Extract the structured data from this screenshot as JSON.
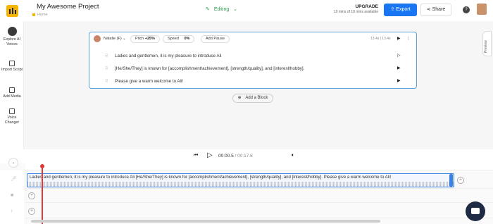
{
  "header": {
    "project_title": "My Awesome Project",
    "breadcrumb": "Home",
    "mode_label": "Editing",
    "upgrade_title": "UPGRADE",
    "upgrade_subtitle": "10 mins of 10 mins available",
    "export_label": "Export",
    "share_label": "Share",
    "help_icon": "?"
  },
  "sidebar": {
    "items": [
      {
        "label": "Explore AI Voices",
        "icon": "avatar-icon"
      },
      {
        "label": "Import Script",
        "icon": "import-icon"
      },
      {
        "label": "Add Media",
        "icon": "media-icon"
      },
      {
        "label": "Voice Changer",
        "icon": "voice-changer-icon"
      }
    ]
  },
  "block": {
    "voice_name": "Natalie (F)",
    "pitch_label": "Pitch",
    "pitch_value": "+25%",
    "speed_label": "Speed",
    "speed_value": "0%",
    "add_pause_label": "Add Pause",
    "duration": "13.4s | 13.4s",
    "lines": [
      "Ladies and gentlemen, it is my pleasure to introduce Ali",
      "[He/She/They] is known for [accomplishment/achievement], [strength/quality], and [interest/hobby].",
      "Please give a warm welcome to Ali!"
    ]
  },
  "add_block_label": "Add a Block",
  "preview_label": "Preview",
  "playback": {
    "current_time": "00:00.5",
    "total_time": "/ 00:17.6"
  },
  "timeline": {
    "clip_text": "Ladies and gentlemen, it is my pleasure to introduce Ali [He/She/They] is known for [accomplishment/achievement], [strength/quality], and [interest/hobby]. Please give a warm welcome to Ali!"
  },
  "colors": {
    "accent": "#1976f2",
    "brand": "#f4b400",
    "playhead": "#e03a3a",
    "editing": "#2e9e4f"
  }
}
